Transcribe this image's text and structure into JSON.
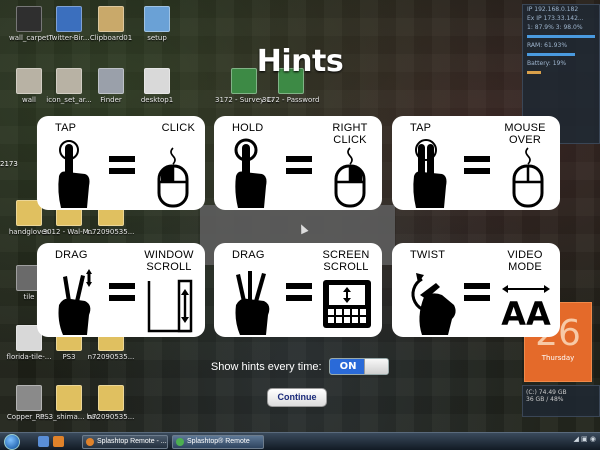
{
  "title": "Hints",
  "desktop_icons": [
    {
      "label": "wall_carpet",
      "color": "#2f2f2f"
    },
    {
      "label": "Twitter-Bir...",
      "color": "#3b6fbe"
    },
    {
      "label": "Clipboard01",
      "color": "#c9a96a"
    },
    {
      "label": "setup",
      "color": "#6aa1d6"
    },
    {
      "label": "wall",
      "color": "#b8b2a4"
    },
    {
      "label": "icon_set_ar...",
      "color": "#b8b2a4"
    },
    {
      "label": "Finder",
      "color": "#9aa0aa"
    },
    {
      "label": "desktop1",
      "color": "#d9d9d9"
    },
    {
      "label": "3172 - Survey Cards (Exce...",
      "color": "#3d8a45"
    },
    {
      "label": "3172 - Password ...",
      "color": "#3d8a45"
    },
    {
      "label": "handgloves",
      "color": "#e0c060"
    },
    {
      "label": "3012 - Wal-M...",
      "color": "#e0c060"
    },
    {
      "label": "n72090535...",
      "color": "#e0c060"
    },
    {
      "label": "tile",
      "color": "#6a6a6a"
    },
    {
      "label": "florida-tile-...",
      "color": "#d8d8d8"
    },
    {
      "label": "PS3",
      "color": "#e0c060"
    },
    {
      "label": "n72090535...",
      "color": "#e0c060"
    },
    {
      "label": "Copper_Ro...",
      "color": "#8a8a8a"
    },
    {
      "label": "PS3_shima... backup",
      "color": "#e0c060"
    },
    {
      "label": "n72090535...",
      "color": "#e0c060"
    }
  ],
  "side_number": "2173",
  "gadgets": {
    "ip1": "IP 192.168.0.182",
    "ip2": "Ex IP 173.33.142...",
    "load": "1: 87.9%  3: 98.0%",
    "ram": "RAM: 61.93%",
    "battery": "Battery: 19%",
    "calendar_day_number": "26",
    "calendar_weekday": "Thursday",
    "disk1": "(C:) 74.49 GB",
    "disk2": "36 GB / 48%"
  },
  "hints": [
    {
      "left": "TAP",
      "right": "CLICK",
      "gesture": "one-finger-tap-icon",
      "target": "mouse-left-click-icon"
    },
    {
      "left": "HOLD",
      "right": "RIGHT CLICK",
      "gesture": "one-finger-hold-icon",
      "target": "mouse-right-click-icon"
    },
    {
      "left": "TAP",
      "right": "MOUSE OVER",
      "gesture": "two-finger-tap-icon",
      "target": "mouse-over-icon"
    },
    {
      "left": "DRAG",
      "right": "WINDOW SCROLL",
      "gesture": "two-finger-drag-icon",
      "target": "window-scroll-icon"
    },
    {
      "left": "DRAG",
      "right": "SCREEN SCROLL",
      "gesture": "three-finger-drag-icon",
      "target": "screen-scroll-icon"
    },
    {
      "left": "TWIST",
      "right": "VIDEO MODE",
      "gesture": "twist-gesture-icon",
      "target": "video-mode-icon"
    }
  ],
  "video_mode_glyph": "AA",
  "toggle": {
    "label": "Show hints every time:",
    "state": "ON",
    "on_color": "#2a6ad8"
  },
  "continue_label": "Continue",
  "taskbar": {
    "tasks": [
      "Splashtop Remote - ...",
      "Splashtop® Remote"
    ]
  }
}
